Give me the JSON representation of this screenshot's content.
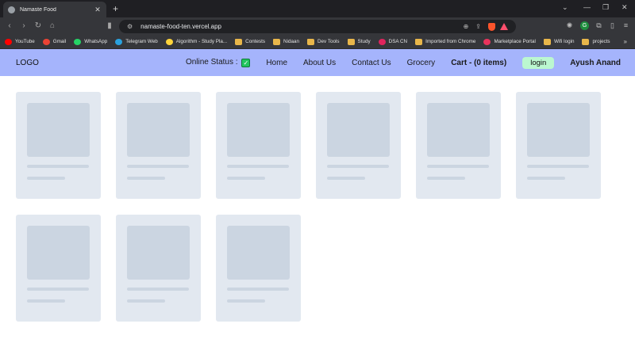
{
  "browser": {
    "tab_title": "Namaste Food",
    "url": "namaste-food-ten.vercel.app",
    "bookmarks": [
      {
        "label": "YouTube",
        "icon": "youtube-icon",
        "color": "#ff0000"
      },
      {
        "label": "Gmail",
        "icon": "gmail-icon",
        "color": "#ea4335"
      },
      {
        "label": "WhatsApp",
        "icon": "whatsapp-icon",
        "color": "#25d366"
      },
      {
        "label": "Telegram Web",
        "icon": "telegram-icon",
        "color": "#2aa1de"
      },
      {
        "label": "Algorithm - Study Pla...",
        "icon": "python-icon",
        "color": "#ffd43b"
      },
      {
        "label": "Contests",
        "icon": "folder-icon",
        "color": "#e8b64a"
      },
      {
        "label": "Nidaan",
        "icon": "folder-icon",
        "color": "#e8b64a"
      },
      {
        "label": "Dev Tools",
        "icon": "folder-icon",
        "color": "#e8b64a"
      },
      {
        "label": "Study",
        "icon": "folder-icon",
        "color": "#e8b64a"
      },
      {
        "label": "DSA CN",
        "icon": "cn-icon",
        "color": "#e0245e"
      },
      {
        "label": "Imported from Chrome",
        "icon": "folder-icon",
        "color": "#e8b64a"
      },
      {
        "label": "Marketplace Portal",
        "icon": "marketplace-icon",
        "color": "#e8335c"
      },
      {
        "label": "Wifi login",
        "icon": "folder-icon",
        "color": "#e8b64a"
      },
      {
        "label": "projects",
        "icon": "folder-icon",
        "color": "#e8b64a"
      }
    ]
  },
  "header": {
    "logo": "LOGO",
    "online_status_label": "Online Status :",
    "online_status_icon": "✓",
    "nav": {
      "home": "Home",
      "about": "About Us",
      "contact": "Contact Us",
      "grocery": "Grocery",
      "cart": "Cart - (0 items)"
    },
    "login_label": "login",
    "user_name": "Ayush Anand"
  },
  "colors": {
    "header_bg": "#a5b4fc",
    "login_bg": "#bbf7d0",
    "card_bg": "#e2e8f0",
    "shimmer": "#cbd5e1"
  }
}
